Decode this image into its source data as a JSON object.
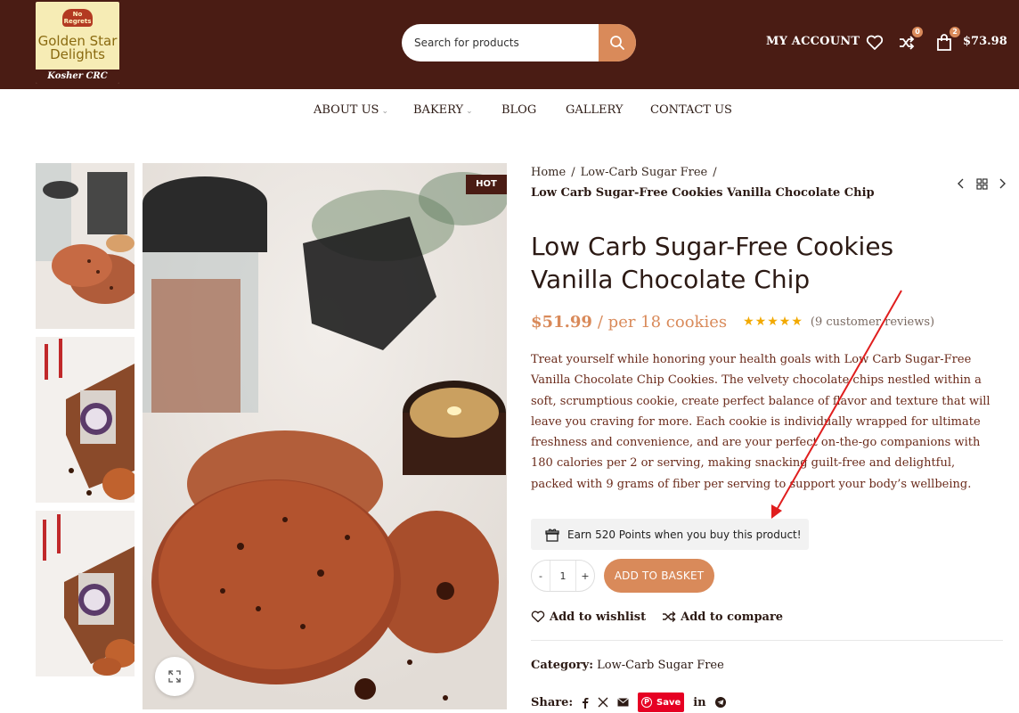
{
  "header": {
    "logo": {
      "crest_text": "No Regrets",
      "line1": "Golden Star",
      "line2": "Delights",
      "tagline": "Kosher CRC"
    },
    "search": {
      "placeholder": "Search for products"
    },
    "account_label": "MY ACCOUNT",
    "compare_count": "0",
    "cart_count": "2",
    "cart_total": "$73.98"
  },
  "nav": {
    "items": [
      {
        "label": "ABOUT US",
        "has_dropdown": true
      },
      {
        "label": "BAKERY",
        "has_dropdown": true
      },
      {
        "label": "BLOG",
        "has_dropdown": false
      },
      {
        "label": "GALLERY",
        "has_dropdown": false
      },
      {
        "label": "CONTACT US",
        "has_dropdown": false
      }
    ]
  },
  "gallery": {
    "badge": "HOT"
  },
  "product": {
    "breadcrumb": [
      "Home",
      "Low-Carb Sugar Free"
    ],
    "breadcrumb_current": "Low Carb Sugar-Free Cookies Vanilla Chocolate Chip",
    "title_line1": "Low Carb Sugar-Free Cookies",
    "title_line2": "Vanilla Chocolate Chip",
    "price": "$51.99",
    "per": "/ per 18 cookies",
    "rating": 5,
    "reviews_text": "(9 customer reviews)",
    "description": "Treat yourself while honoring your health goals with Low Carb Sugar-Free Vanilla Chocolate Chip Cookies. The velvety chocolate chips nestled within a soft, scrumptious cookie, create perfect balance of flavor and texture that will leave you craving for more. Each cookie is individually wrapped for ultimate freshness and convenience, and are your perfect on-the-go companions with 180 calories per 2 or serving, making snacking guilt-free and delightful, packed with 9 grams of fiber per serving to support your body’s wellbeing.",
    "points_text": "Earn 520 Points when you buy this product!",
    "quantity": {
      "minus": "-",
      "value": "1",
      "plus": "+"
    },
    "add_to_basket": "ADD TO BASKET",
    "wishlist_label": "Add to wishlist",
    "compare_label": "Add to compare",
    "category_label": "Category:",
    "category_value": "Low-Carb Sugar Free",
    "share_label": "Share:",
    "pin_save_label": "Save",
    "linkedin_label": "in"
  },
  "colors": {
    "header_bg": "#4a1c14",
    "accent": "#d98a5a",
    "annotation_arrow": "#e01e1e"
  }
}
